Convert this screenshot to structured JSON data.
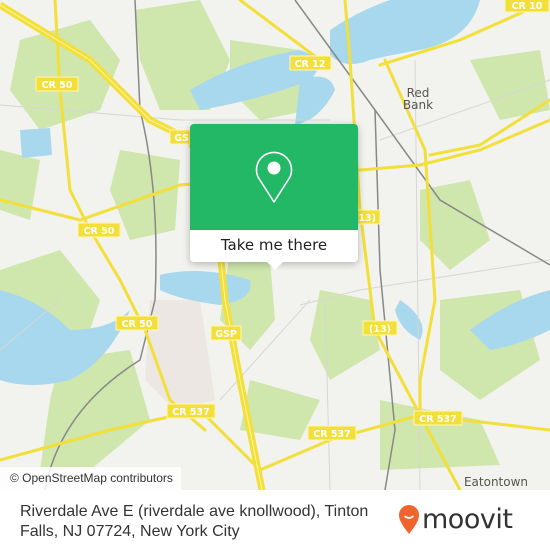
{
  "map": {
    "road_labels": {
      "cr10": "CR 10",
      "cr12": "CR 12",
      "cr50_a": "CR 50",
      "cr50_b": "CR 50",
      "cr50_c": "CR 50",
      "gsp_a": "GSP",
      "gsp_b": "GSP",
      "r13_a": "(13)",
      "r13_b": "(13)",
      "cr537_a": "CR 537",
      "cr537_b": "CR 537",
      "cr537_c": "CR 537"
    },
    "places": {
      "red_bank_1": "Red",
      "red_bank_2": "Bank",
      "eatontown": "Eatontown"
    },
    "attribution": "© OpenStreetMap contributors",
    "colors": {
      "land": "#f2f2ee",
      "water": "#a8d8ee",
      "park": "#cfe6ad",
      "road": "#f3df3a",
      "accent": "#22b866"
    }
  },
  "popup": {
    "icon": "map-pin-icon",
    "button_label": "Take me there"
  },
  "footer": {
    "address": "Riverdale Ave E (riverdale ave knollwood), Tinton Falls, NJ 07724, New York City",
    "logo_text": "moovit",
    "logo_color": "#f0642d"
  }
}
